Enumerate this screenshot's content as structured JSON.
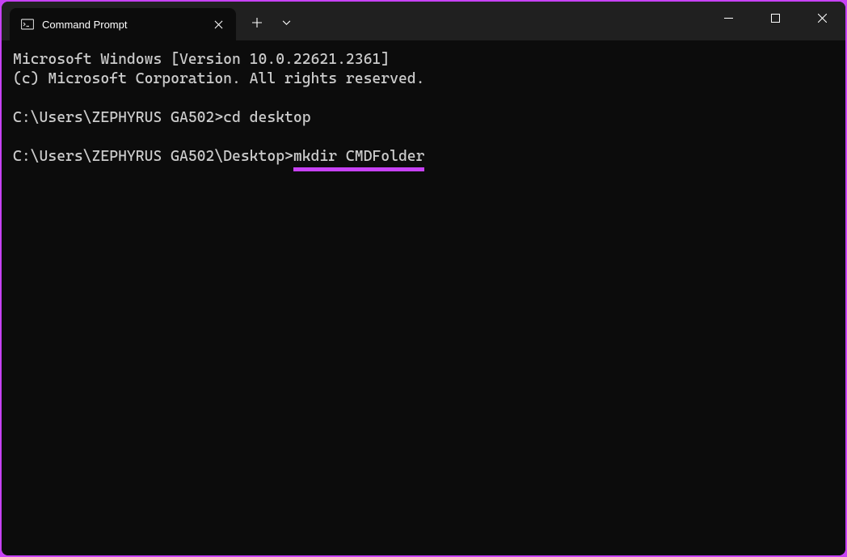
{
  "tab": {
    "title": "Command Prompt"
  },
  "terminal": {
    "line1": "Microsoft Windows [Version 10.0.22621.2361]",
    "line2": "(c) Microsoft Corporation. All rights reserved.",
    "prompt1": "C:\\Users\\ZEPHYRUS GA502>",
    "command1": "cd desktop",
    "prompt2": "C:\\Users\\ZEPHYRUS GA502\\Desktop>",
    "command2": "mkdir CMDFolder"
  }
}
